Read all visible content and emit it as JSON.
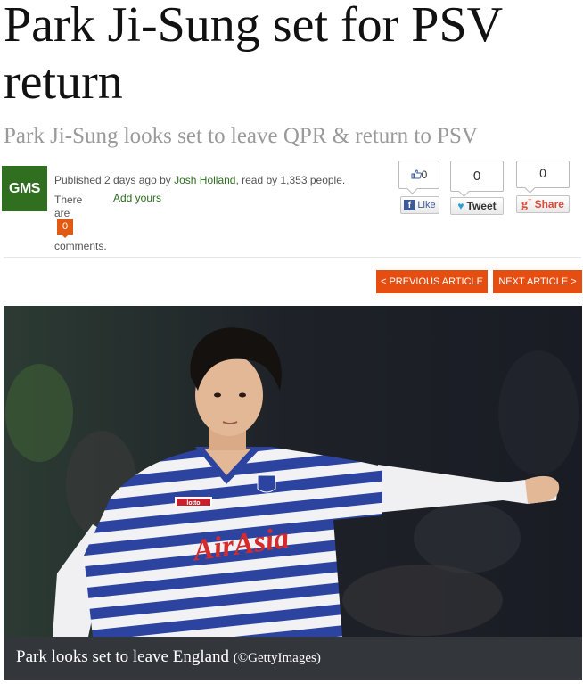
{
  "article": {
    "title": "Park Ji-Sung set for PSV return",
    "subtitle": "Park Ji-Sung looks set to leave QPR & return to PSV"
  },
  "meta": {
    "logo": "GMS",
    "published_prefix": "Published 2 days ago by ",
    "author": "Josh Holland",
    "read_suffix": ", read by 1,353 people.",
    "there_are": "There are",
    "comment_count": "0",
    "comments_label": "comments.",
    "add_yours": "Add yours"
  },
  "social": {
    "facebook_count": "0",
    "facebook_label": "Like",
    "twitter_count": "0",
    "twitter_label": "Tweet",
    "gplus_count": "0",
    "gplus_label": "Share"
  },
  "nav": {
    "previous": "< PREVIOUS ARTICLE",
    "next": "NEXT ARTICLE >"
  },
  "image": {
    "sponsor": "AirAsia",
    "shirt_brand": "lotto",
    "caption": "Park looks set to leave England ",
    "credit": "(©GettyImages)"
  },
  "icons": [
    "thumbs-up-icon",
    "facebook-icon",
    "twitter-icon",
    "google-plus-icon"
  ],
  "colors": {
    "accent": "#e54e10",
    "brand_green": "#2f6f1f",
    "caption_bg": "#33363b"
  }
}
